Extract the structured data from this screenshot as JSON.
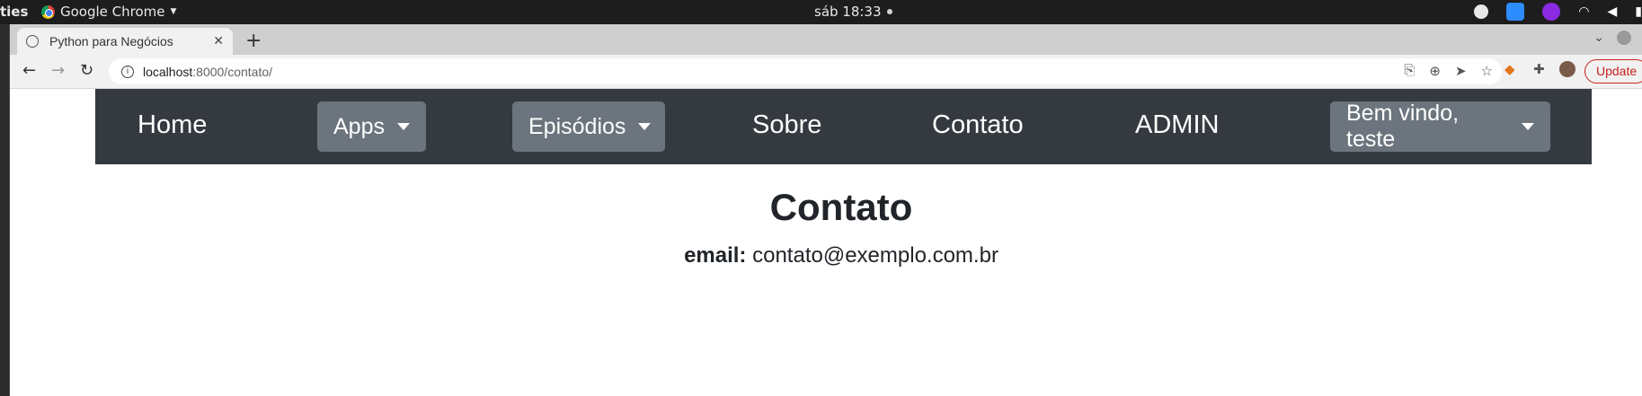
{
  "system_bar": {
    "activities": "ties",
    "app_name": "Google Chrome",
    "clock": "sáb 18:33"
  },
  "browser": {
    "tab_title": "Python para Negócios",
    "new_tab": "+",
    "url_host": "localhost",
    "url_path": ":8000/contato/",
    "update_label": "Update"
  },
  "navbar": {
    "home": "Home",
    "apps": "Apps",
    "episodios": "Episódios",
    "sobre": "Sobre",
    "contato": "Contato",
    "admin": "ADMIN",
    "user_menu": "Bem vindo, teste"
  },
  "content": {
    "heading": "Contato",
    "email_label": "email:",
    "email_value": "contato@exemplo.com.br"
  }
}
